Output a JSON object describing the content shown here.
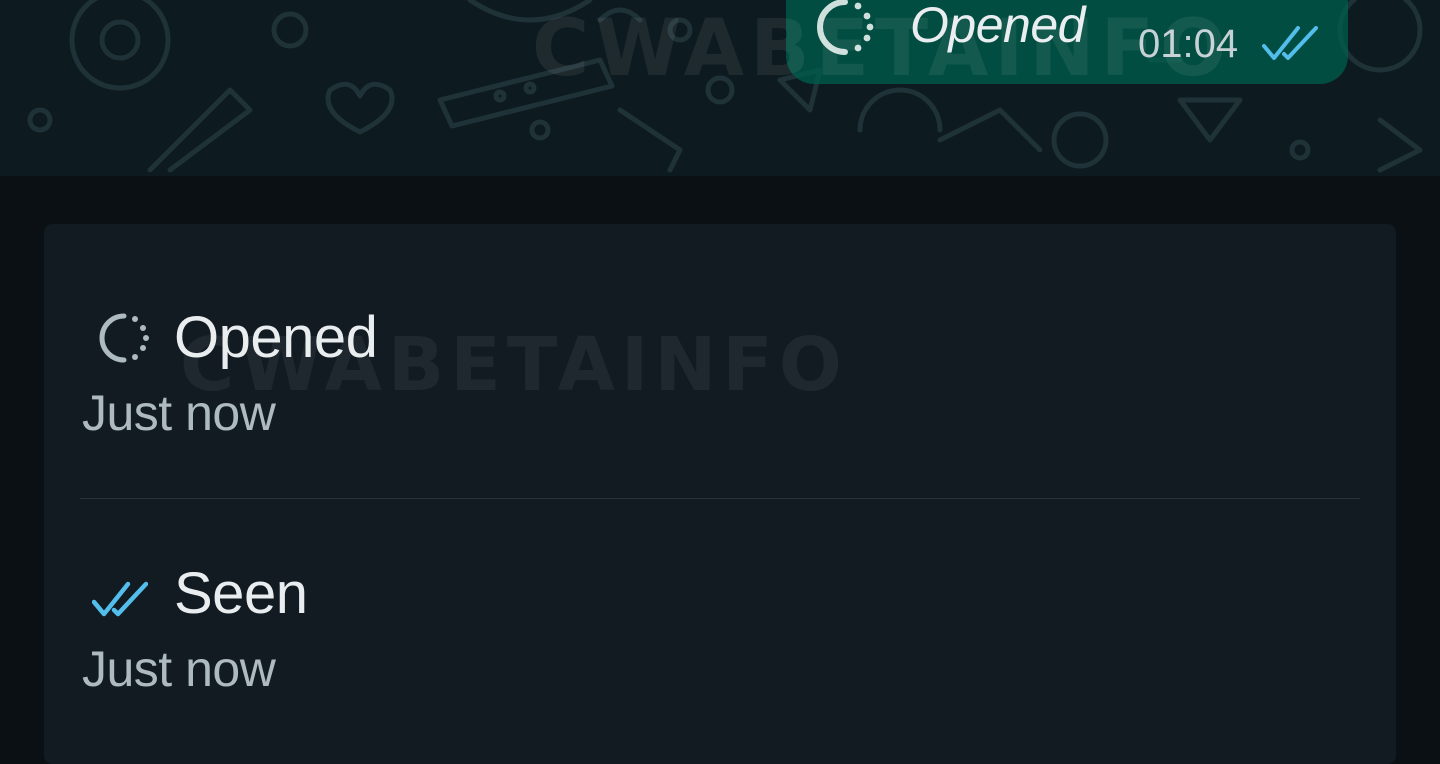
{
  "chat": {
    "bubble": {
      "status_icon": "opened-ring-icon",
      "text": "Opened",
      "time": "01:04",
      "receipt_icon": "double-check-icon",
      "bubble_color": "#005c4b",
      "tick_color": "#53bdeb"
    }
  },
  "watermark": "CWABETAINFO",
  "message_info": {
    "rows": [
      {
        "icon": "opened-ring-icon",
        "title": "Opened",
        "time": "Just now"
      },
      {
        "icon": "double-check-icon",
        "title": "Seen",
        "time": "Just now"
      }
    ]
  },
  "colors": {
    "background": "#0b1014",
    "card": "#111b21",
    "primary_text": "#e9edef",
    "secondary_text": "#aebac1",
    "read_blue": "#53bdeb"
  }
}
